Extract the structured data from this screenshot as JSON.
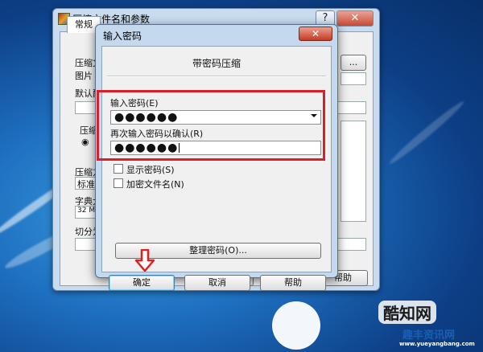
{
  "background_window": {
    "title": "压缩文件名和参数",
    "help_button": "?",
    "close_button": "✕",
    "tab_general": "常规",
    "fragments": {
      "compress_name": "压缩文",
      "pictures": "图片",
      "default": "默认配",
      "compress": "压缩",
      "compress_method": "压缩方",
      "standard": "标准",
      "dictionary": "字典大",
      "dict_value": "32 M",
      "split": "切分为"
    },
    "buttons": {
      "ok": "确定",
      "cancel": "取消",
      "help": "帮助"
    }
  },
  "password_dialog": {
    "title": "输入密码",
    "close": "✕",
    "heading": "带密码压缩",
    "enter_label": "输入密码(E)",
    "enter_value": "●●●●●●",
    "confirm_label": "再次输入密码以确认(R)",
    "confirm_value": "●●●●●●",
    "show_password": "显示密码(S)",
    "encrypt_names": "加密文件名(N)",
    "organize_button": "整理密码(O)...",
    "ok_button": "确定",
    "cancel_button": "取消",
    "help_button": "帮助"
  },
  "watermark": {
    "main_text": "酷知网",
    "sub_text": "趣丰资讯网",
    "url": "www.yueyangbang.com"
  },
  "colors": {
    "highlight": "#d8202a",
    "arrow": "#e02020"
  }
}
